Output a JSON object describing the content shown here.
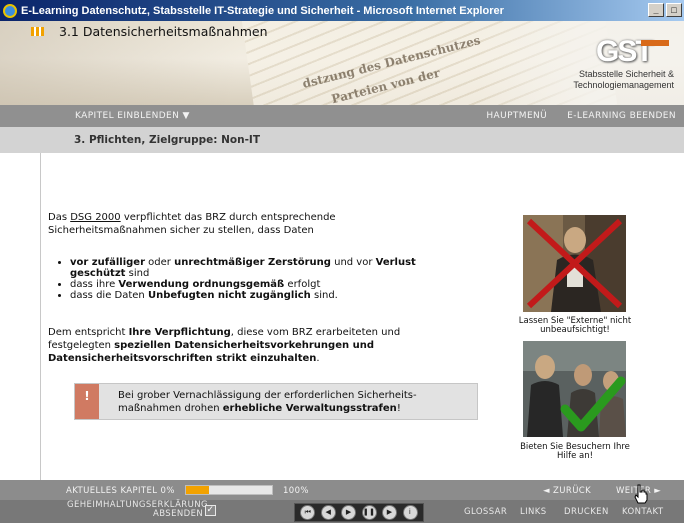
{
  "window": {
    "title": "E-Learning Datenschutz, Stabsstelle IT-Strategie und Sicherheit - Microsoft Internet Explorer"
  },
  "branding": {
    "slogan_line1": "Stabsstelle Sicherheit &",
    "slogan_line2": "Technologiemanagement"
  },
  "nav": {
    "kapitel": "KAPITEL EINBLENDEN ▼",
    "hauptmenu": "HAUPTMENÜ",
    "beenden": "E-LEARNING BEENDEN"
  },
  "subheader": {
    "title": "3. Pflichten, Zielgruppe: Non-IT"
  },
  "section": {
    "title": "3.1 Datensicherheitsmaßnahmen"
  },
  "intro": {
    "pre": "Das ",
    "link": "DSG 2000",
    "post": " verpflichtet das BRZ durch entsprechende",
    "line2": "Sicherheitsmaßnahmen sicher zu stellen, dass Daten"
  },
  "bullets": {
    "b1_a": "vor zufälliger",
    "b1_b": " oder ",
    "b1_c": "unrechtmäßiger Zerstörung",
    "b1_d": " und vor ",
    "b1_e": "Verlust",
    "b1_f": "geschützt",
    "b1_g": " sind",
    "b2_a": "dass ihre ",
    "b2_b": "Verwendung ordnungsgemäß",
    "b2_c": " erfolgt",
    "b3_a": "dass die Daten ",
    "b3_b": "Unbefugten nicht zugänglich",
    "b3_c": " sind."
  },
  "para2": {
    "l1a": "Dem entspricht ",
    "l1b": "Ihre Verpflichtung",
    "l1c": ", diese vom BRZ erarbeiteten und",
    "l2a": "festgelegten ",
    "l2b": "speziellen Datensicherheitsvorkehrungen und",
    "l3a": "Datensicherheitsvorschriften strikt einzuhalten",
    "l3b": "."
  },
  "warning": {
    "icon": "!",
    "line1": "Bei grober Vernachlässigung der erforderlichen Sicherheits-",
    "line2a": "maßnahmen drohen ",
    "line2b": "erhebliche Verwaltungsstrafen",
    "line2c": "!"
  },
  "photos": {
    "cap1_l1": "Lassen Sie \"Externe\" nicht",
    "cap1_l2": "unbeaufsichtigt!",
    "cap2_l1": "Bieten Sie Besuchern Ihre",
    "cap2_l2": "Hilfe an!"
  },
  "footer": {
    "chapter_label": "AKTUELLES KAPITEL 0%",
    "progress_fraction": 0.27,
    "percent_end": "100%",
    "zurueck": "◄ ZURÜCK",
    "weiter": "WEITER ►",
    "privacy_l1": "GEHEIMHALTUNGSERKLÄRUNG",
    "privacy_l2": "ABSENDEN",
    "glossar": "GLOSSAR",
    "links": "LINKS",
    "drucken": "DRUCKEN",
    "kontakt": "KONTAKT"
  },
  "player_icons": [
    "skip-back-icon",
    "rewind-icon",
    "play-icon",
    "pause-icon",
    "forward-icon",
    "info-icon"
  ],
  "colors": {
    "accent": "#f2a200",
    "nav_bg": "#909090",
    "subhead_bg": "#d3d3d3",
    "warn_icon": "#d07a62",
    "cross": "#c21a1a",
    "check": "#2a9a1e"
  }
}
